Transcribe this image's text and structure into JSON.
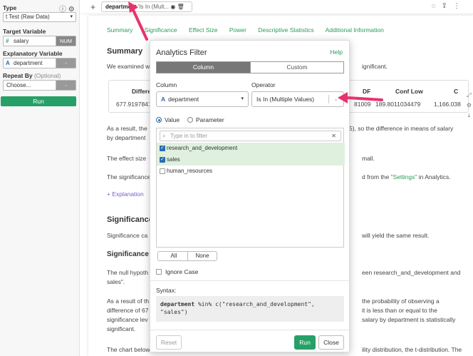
{
  "sidebar": {
    "type_label": "Type",
    "type_value": "t Test (Raw Data)",
    "target_label": "Target Variable",
    "target_value": "salary",
    "target_tag": "NUM",
    "explanatory_label": "Explanatory Variable",
    "explanatory_value": "department",
    "explanatory_tag": "-",
    "repeat_label": "Repeat By",
    "repeat_optional": "(Optional)",
    "repeat_value": "Choose...",
    "repeat_tag": "-",
    "run_label": "Run"
  },
  "topbar": {
    "chip_field": "department",
    "chip_rest": "'Is In (Mult..."
  },
  "main": {
    "tabs": [
      "Summary",
      "Significance",
      "Effect Size",
      "Power",
      "Descriptive Statistics",
      "Additional Information"
    ],
    "summary_heading": "Summary",
    "para1_left": "We examined w",
    "para1_right": "ignificant.",
    "stats": {
      "headers": [
        "Differe",
        "DF",
        "Conf Low",
        "C"
      ],
      "values": [
        "677.9197841",
        "81009",
        "189.8011034479",
        "1,166.038"
      ]
    },
    "para2_left": "As a result, the",
    "para2_right": "5), so the difference in means of salary",
    "para2_line2": "by department",
    "para3_left": "The effect size",
    "para3_right": "mall.",
    "para4_left": "The significance",
    "para4_right_pre": "d from the ",
    "para4_link": "\"Settings\"",
    "para4_right_post": " in Analytics.",
    "explanation": "+ Explanation",
    "significance_heading": "Significance",
    "para5_left": "Significance ca",
    "para5_right": "will yield the same result.",
    "significance_sub": "Significance -",
    "para6_left": "The null hypoth",
    "para6_right": "een research_and_development and",
    "para6_line2": "sales\".",
    "para7_left": "As a result of th",
    "para7_right": "the probability of observing a",
    "para7_line2_left": "difference of 67",
    "para7_line2_right": "it is less than or equal to the",
    "para7_line3_left": "significance lev",
    "para7_line3_right": "salary by department is statistically",
    "para7_line4": "significant.",
    "para8_left": "The chart below",
    "para8_right": "ility distribution, the t-distribution. The"
  },
  "modal": {
    "title": "Analytics Filter",
    "help": "Help",
    "seg_column": "Column",
    "seg_custom": "Custom",
    "column_label": "Column",
    "column_value": "department",
    "operator_label": "Operator",
    "operator_value": "Is In (Multiple Values)",
    "radio_value": "Value",
    "radio_parameter": "Parameter",
    "search_placeholder": "Type in to filter",
    "items": [
      {
        "label": "research_and_development",
        "checked": true
      },
      {
        "label": "sales",
        "checked": true
      },
      {
        "label": "human_resources",
        "checked": false
      }
    ],
    "all_btn": "All",
    "none_btn": "None",
    "ignore_case": "Ignore Case",
    "syntax_label": "Syntax:",
    "syntax_kw": "department",
    "syntax_rest": " %in% c(\"research_and_development\",\n\"sales\")",
    "reset": "Reset",
    "run": "Run",
    "close": "Close"
  },
  "colors": {
    "accent_green": "#27a067",
    "link_green": "#2a9d5b",
    "pink_arrow": "#e8336d",
    "selected_row": "#dff0df",
    "checkbox_blue": "#2b6cb0"
  }
}
